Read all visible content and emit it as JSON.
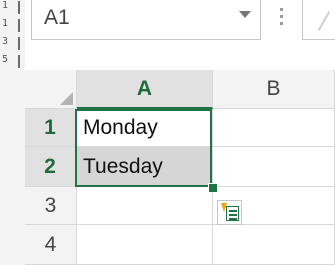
{
  "editor_gutter": {
    "lines": [
      "1",
      "1",
      "3",
      "5"
    ]
  },
  "name_box": {
    "value": "A1"
  },
  "columns": [
    "A",
    "B"
  ],
  "rows": [
    {
      "num": "1",
      "a": "Monday",
      "b": ""
    },
    {
      "num": "2",
      "a": "Tuesday",
      "b": ""
    },
    {
      "num": "3",
      "a": "",
      "b": ""
    },
    {
      "num": "4",
      "a": "",
      "b": ""
    }
  ],
  "colors": {
    "accent": "#217346",
    "header_bg": "#f3f3f3",
    "selected_fill": "#d6d6d6"
  },
  "icons": {
    "flash_fill": "flash-fill-options-icon",
    "dropdown": "chevron-down-icon"
  }
}
